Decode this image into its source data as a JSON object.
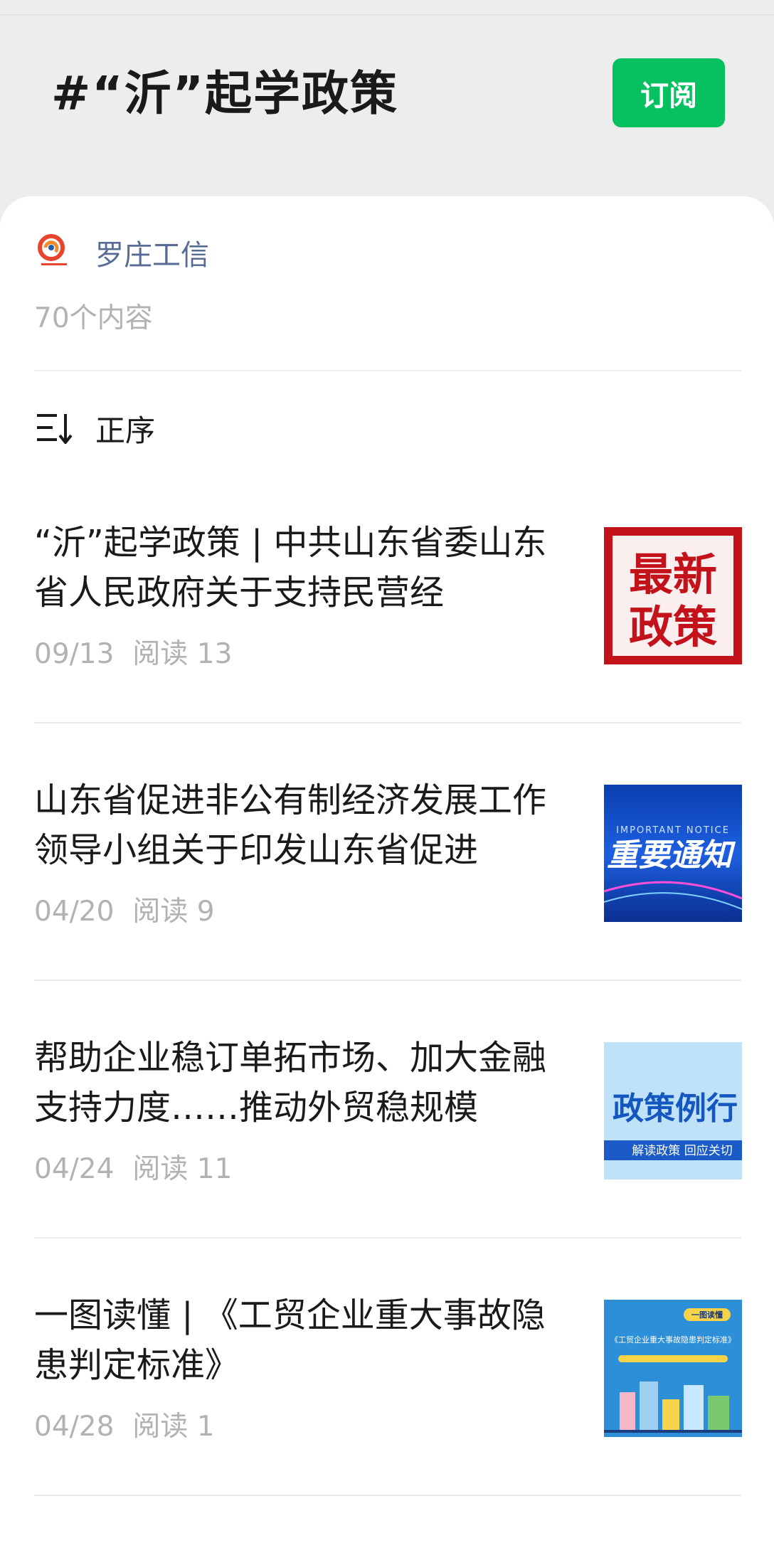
{
  "header": {
    "title": "#“沂”起学政策",
    "subscribe_label": "订阅"
  },
  "author": {
    "name": "罗庄工信",
    "content_count": "70个内容"
  },
  "sort": {
    "label": "正序"
  },
  "articles": [
    {
      "title": "“沂”起学政策 | 中共山东省委山东省人民政府关于支持民营经",
      "date": "09/13",
      "reads": "阅读 13",
      "thumb_text": [
        "最新",
        "政策"
      ]
    },
    {
      "title": "山东省促进非公有制经济发展工作领导小组关于印发山东省促进",
      "date": "04/20",
      "reads": "阅读 9",
      "thumb_text": [
        "IMPORTANT NOTICE",
        "重要通知"
      ]
    },
    {
      "title": "帮助企业稳订单拓市场、加大金融支持力度……推动外贸稳规模",
      "date": "04/24",
      "reads": "阅读 11",
      "thumb_text": [
        "政策例行",
        "解读政策 回应关切"
      ]
    },
    {
      "title": "一图读懂 | 《工贸企业重大事故隐患判定标准》",
      "date": "04/28",
      "reads": "阅读 1",
      "thumb_text": [
        "一图读懂",
        "《工贸企业重大事故隐患判定标准》"
      ]
    }
  ],
  "colors": {
    "accent_green": "#07c160",
    "author_link": "#576b95",
    "meta_gray": "#b2b2b2"
  }
}
